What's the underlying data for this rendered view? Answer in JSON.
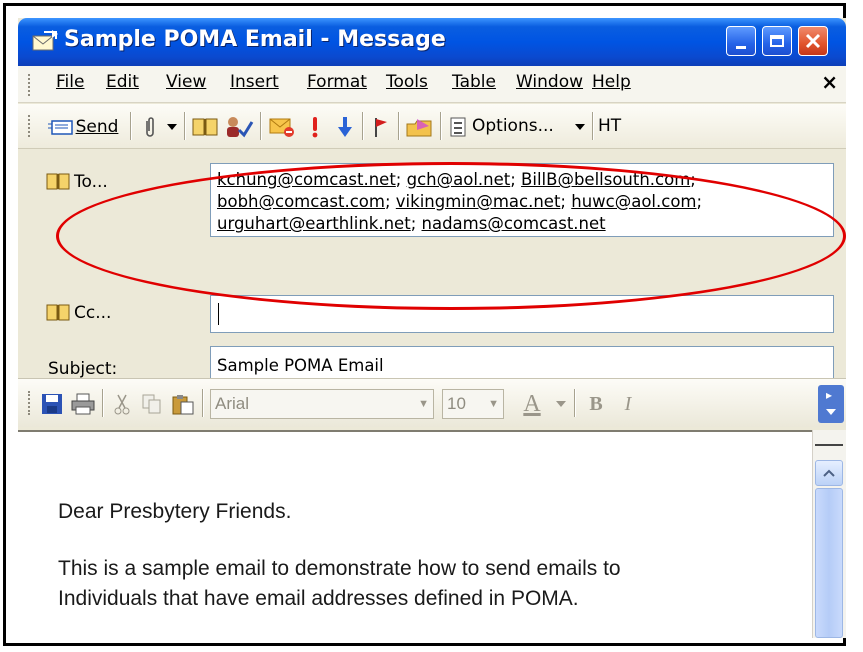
{
  "window": {
    "title": "Sample POMA Email - Message",
    "controls": [
      "minimize",
      "maximize",
      "close"
    ]
  },
  "menubar": {
    "items": [
      "File",
      "Edit",
      "View",
      "Insert",
      "Format",
      "Tools",
      "Table",
      "Window",
      "Help"
    ],
    "close_glyph": "×"
  },
  "toolbar": {
    "send_label": "Send",
    "options_label": "Options...",
    "html_label": "HT",
    "icons": [
      "send-icon",
      "attach-icon",
      "address-book-icon",
      "check-names-icon",
      "importance-high-icon",
      "importance-low-icon",
      "flag-icon",
      "permission-icon",
      "options-icon"
    ]
  },
  "fields": {
    "to_label": "To...",
    "to_lines": [
      [
        "kchung@comcast.net",
        "gch@aol.net",
        "BillB@bellsouth.com"
      ],
      [
        "bobh@comcast.com",
        "vikingmin@mac.net",
        "huwc@aol.com"
      ],
      [
        "urguhart@earthlink.net",
        "nadams@comcast.net"
      ]
    ],
    "separator": "; ",
    "cc_label": "Cc...",
    "cc_value": "",
    "subject_label": "Subject:",
    "subject_value": "Sample POMA Email"
  },
  "format_toolbar": {
    "font": "Arial",
    "size": "10",
    "bold": "B",
    "italic": "I",
    "font_color": "A"
  },
  "body": {
    "line1": "Dear Presbytery Friends.",
    "line2": "This is a sample email to demonstrate how to send emails to",
    "line3": "Individuals that have email addresses defined in POMA."
  },
  "annotation": {
    "color": "#e00000",
    "shape": "ellipse"
  },
  "colors": {
    "titlebar": "#0054e3",
    "chrome": "#ece9d8",
    "close": "#e1542c"
  }
}
